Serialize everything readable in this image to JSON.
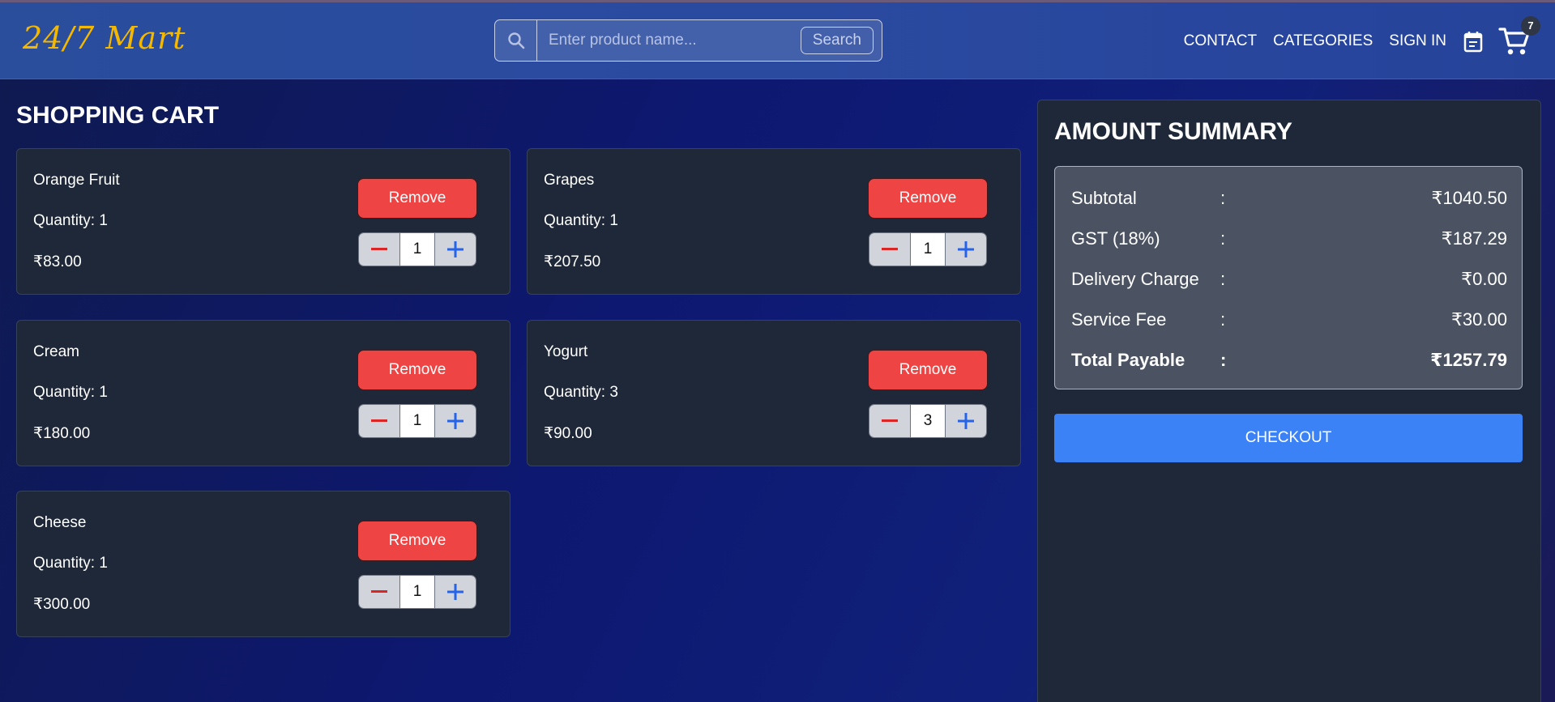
{
  "header": {
    "logo": "24/7 Mart",
    "search_placeholder": "Enter product name...",
    "search_button": "Search",
    "nav": [
      "CONTACT",
      "CATEGORIES",
      "SIGN IN"
    ],
    "cart_count": "7"
  },
  "cart": {
    "title": "SHOPPING CART",
    "remove_label": "Remove",
    "items": [
      {
        "name": "Orange Fruit",
        "quantity_text": "Quantity: 1",
        "price": "₹83.00",
        "qty": "1"
      },
      {
        "name": "Grapes",
        "quantity_text": "Quantity: 1",
        "price": "₹207.50",
        "qty": "1"
      },
      {
        "name": "Cream",
        "quantity_text": "Quantity: 1",
        "price": "₹180.00",
        "qty": "1"
      },
      {
        "name": "Yogurt",
        "quantity_text": "Quantity: 3",
        "price": "₹90.00",
        "qty": "3"
      },
      {
        "name": "Cheese",
        "quantity_text": "Quantity: 1",
        "price": "₹300.00",
        "qty": "1"
      }
    ]
  },
  "summary": {
    "title": "AMOUNT SUMMARY",
    "rows": [
      {
        "label": "Subtotal",
        "colon": ":",
        "value": "₹1040.50"
      },
      {
        "label": "GST (18%)",
        "colon": ":",
        "value": "₹187.29"
      },
      {
        "label": "Delivery Charge",
        "colon": ":",
        "value": "₹0.00"
      },
      {
        "label": "Service Fee",
        "colon": ":",
        "value": "₹30.00"
      },
      {
        "label": "Total Payable",
        "colon": ":",
        "value": "₹1257.79"
      }
    ],
    "checkout_label": "CHECKOUT"
  },
  "colors": {
    "accent": "#3b82f6",
    "danger": "#ef4444",
    "logo": "#f5b800",
    "card_bg": "#1f2838"
  },
  "icons": [
    "search-icon",
    "calendar-icon",
    "cart-icon",
    "minus-icon",
    "plus-icon"
  ]
}
